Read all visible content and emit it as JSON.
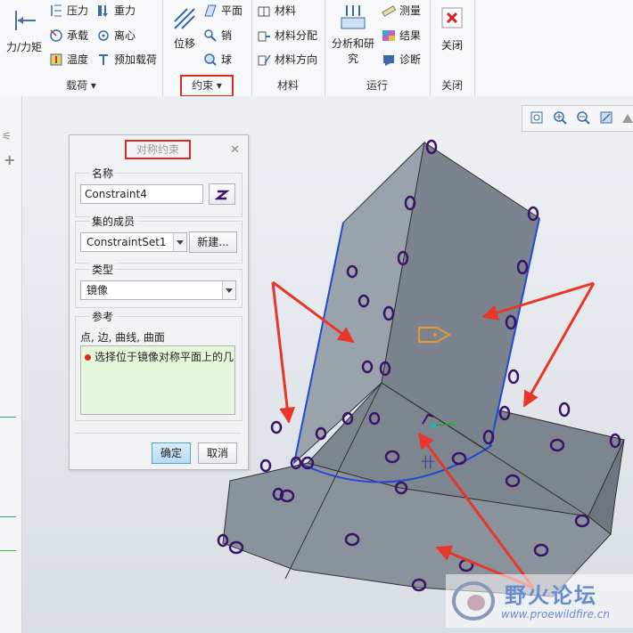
{
  "ribbon": {
    "load_group": {
      "label": "载荷",
      "big_button": "力/力矩",
      "items": [
        "压力",
        "重力",
        "承载",
        "离心",
        "温度",
        "预加载荷"
      ]
    },
    "constraint_group": {
      "label": "约束",
      "big_button": "位移",
      "items": [
        "平面",
        "销",
        "球"
      ]
    },
    "material_group": {
      "label": "材料",
      "items": [
        "材料",
        "材料分配",
        "材料方向"
      ]
    },
    "run_group": {
      "label": "运行",
      "big_button": "分析和研究",
      "items": [
        "测量",
        "结果",
        "诊断"
      ]
    },
    "close_group": {
      "label": "关闭",
      "big_button": "关闭"
    }
  },
  "dialog": {
    "title": "对称约束",
    "name_section": {
      "label": "名称",
      "value": "Constraint4"
    },
    "set_section": {
      "label": "集的成员",
      "selected": "ConstraintSet1",
      "new_button": "新建..."
    },
    "type_section": {
      "label": "类型",
      "selected": "镜像"
    },
    "ref_section": {
      "label": "参考",
      "hint": "点, 边, 曲线, 曲面",
      "list_item": "选择位于镜像对称平面上的几"
    },
    "ok_button": "确定",
    "cancel_button": "取消"
  },
  "watermark": {
    "name": "野火论坛",
    "url": "www.proewildfire.cn"
  },
  "colors": {
    "accent_red": "#e0281e",
    "model_fill": "#7b848e",
    "selected_edge": "#1f4bd6",
    "highlight_green": "#e6f7da"
  }
}
